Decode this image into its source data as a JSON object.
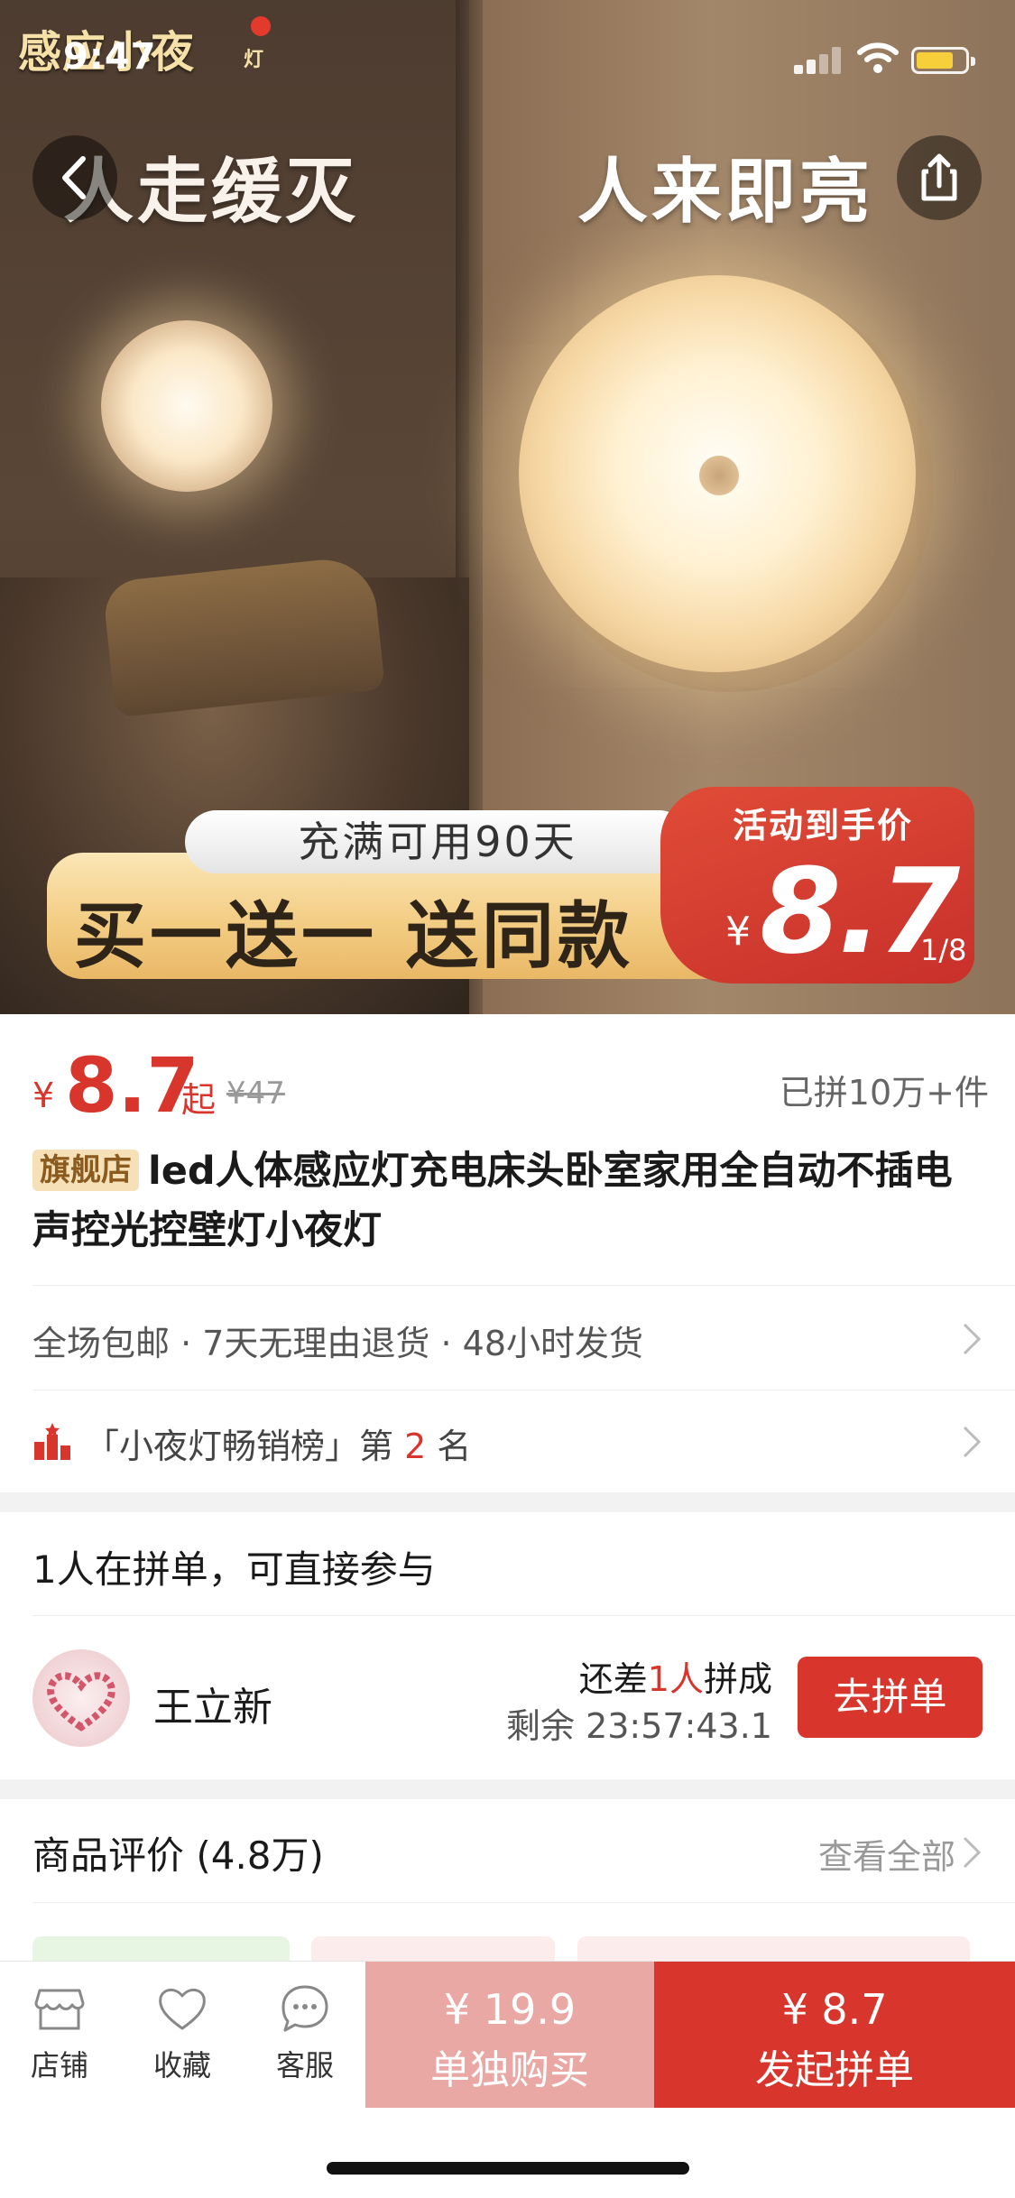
{
  "status_bar": {
    "time": "9:47"
  },
  "hero": {
    "brand_text": "感应小夜",
    "brand_sub": "灯",
    "headline_left": "人走缓灭",
    "headline_right": "人来即亮",
    "banner_top": "充满可用90天",
    "banner_main": "买一送一 送同款",
    "badge_label": "活动到手价",
    "badge_currency": "¥",
    "badge_price": "8.7",
    "image_counter": "1/8"
  },
  "price": {
    "currency": "¥",
    "current": "8.7",
    "suffix": "起",
    "original": "¥47",
    "sold": "已拼10万+件"
  },
  "product": {
    "tag": "旗舰店",
    "title": "led人体感应灯充电床头卧室家用全自动不插电声控光控壁灯小夜灯"
  },
  "services": {
    "text": "全场包邮 · 7天无理由退货 · 48小时发货"
  },
  "ranking": {
    "prefix": "「小夜灯畅销榜」第",
    "rank": "2",
    "suffix": "名"
  },
  "group_buy": {
    "heading": "1人在拼单，可直接参与",
    "user_name": "王立新",
    "need_prefix": "还差",
    "need_count": "1人",
    "need_suffix": "拼成",
    "remaining": "剩余 23:57:43.1",
    "join_label": "去拼单"
  },
  "reviews": {
    "heading": "商品评价 (4.8万)",
    "view_all": "查看全部"
  },
  "bottom_bar": {
    "store_label": "店铺",
    "favorite_label": "收藏",
    "service_label": "客服",
    "buy_alone_price": "¥ 19.9",
    "buy_alone_label": "单独购买",
    "buy_group_price": "¥ 8.7",
    "buy_group_label": "发起拼单"
  },
  "colors": {
    "accent_red": "#d8352c",
    "buy_alone_bg": "#eaa8a4",
    "flagship_tag_bg": "#f6e0b7"
  },
  "icons": {
    "back": "chevron-left-icon",
    "share": "share-icon",
    "store": "store-icon",
    "favorite": "heart-icon",
    "service": "chat-icon",
    "rank": "podium-icon"
  }
}
